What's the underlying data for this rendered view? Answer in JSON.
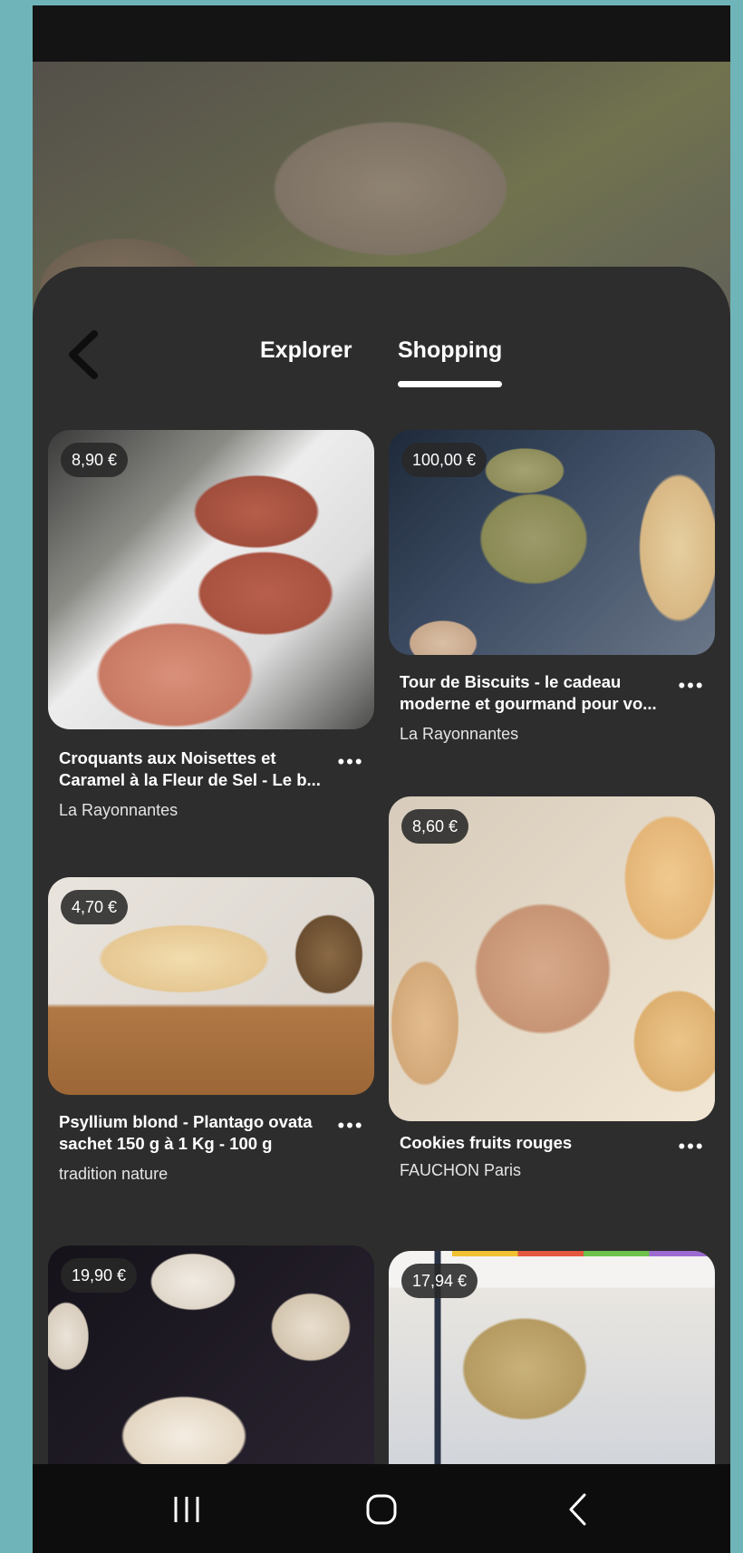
{
  "tabs": [
    {
      "label": "Explorer",
      "active": false
    },
    {
      "label": "Shopping",
      "active": true
    }
  ],
  "products": [
    {
      "price": "8,90 €",
      "title_line1": "Croquants aux Noisettes et",
      "title_line2": "Caramel à la Fleur de Sel - Le b...",
      "store": "La Rayonnantes"
    },
    {
      "price": "100,00 €",
      "title_line1": "Tour de Biscuits - le cadeau",
      "title_line2": "moderne et gourmand pour vo...",
      "store": "La Rayonnantes"
    },
    {
      "price": "4,70 €",
      "title_line1": "Psyllium blond - Plantago ovata",
      "title_line2": "sachet 150 g à 1 Kg - 100 g",
      "store": "tradition nature"
    },
    {
      "price": "8,60 €",
      "title_line1": "Cookies fruits rouges",
      "title_line2": "",
      "store": "FAUCHON Paris"
    },
    {
      "price": "19,90 €"
    },
    {
      "price": "17,94 €"
    }
  ],
  "more_icon": "•••",
  "nav": {
    "recent": "recent-apps-icon",
    "home": "home-icon",
    "back": "back-icon"
  }
}
